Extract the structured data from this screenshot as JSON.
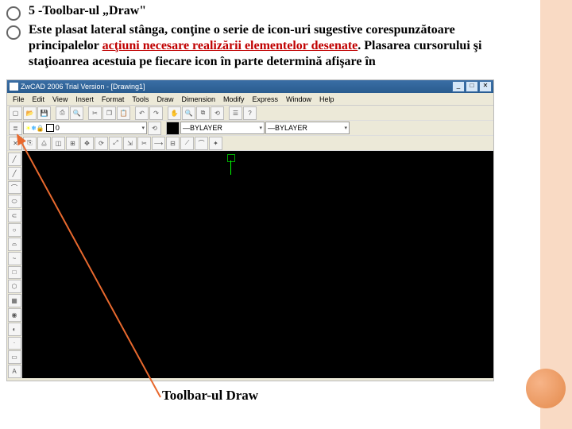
{
  "bullets": {
    "b1": "5 -Toolbar-ul „Draw\"",
    "b2_pre": "Este plasat lateral stânga, conţine o serie de icon-uri sugestive corespunzătoare principalelor ",
    "b2_hl": "acţiuni necesare realizării elementelor desenate",
    "b2_mid": ". Plasarea cursorului şi staţioanrea acestuia pe fiecare icon în parte determină afişare în"
  },
  "app": {
    "title": "ZwCAD 2006 Trial Version - [Drawing1]",
    "menus": [
      "File",
      "Edit",
      "View",
      "Insert",
      "Format",
      "Tools",
      "Draw",
      "Dimension",
      "Modify",
      "Express",
      "Window",
      "Help"
    ]
  },
  "layer_field": "0",
  "linetype_field": "BYLAYER",
  "lineweight_field": "BYLAYER",
  "draw_icons": [
    "╱",
    "╱",
    "⌒",
    "⬭",
    "⊂",
    "○",
    "⌓",
    "~",
    "□",
    "⬡",
    "▦",
    "◉",
    "◐",
    "·",
    "▭",
    "A"
  ],
  "caption": "Toolbar-ul Draw"
}
